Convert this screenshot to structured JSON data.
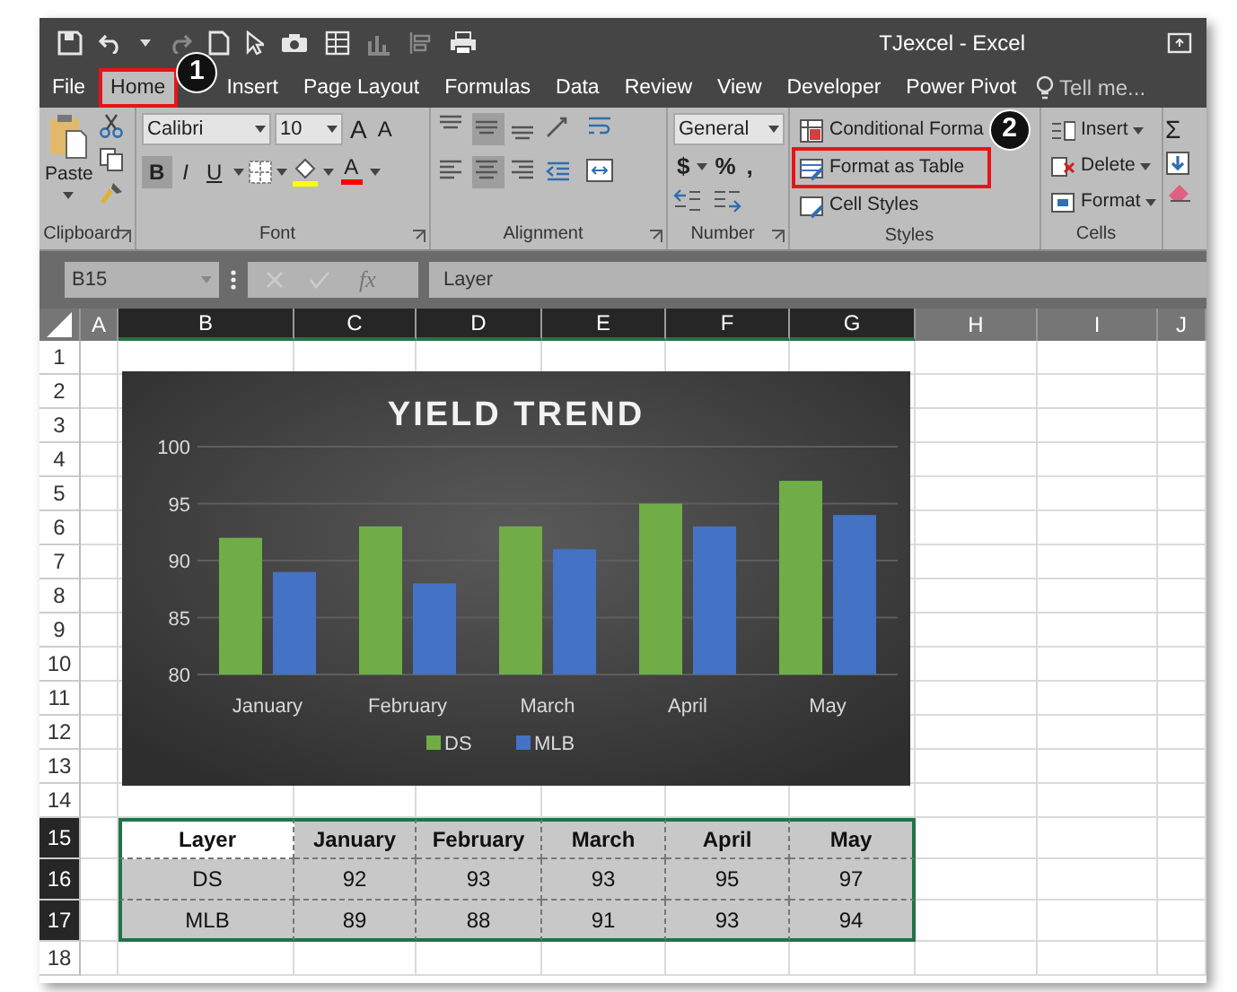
{
  "window": {
    "title": "TJexcel - Excel"
  },
  "tabs": [
    {
      "label": "File",
      "selected": false,
      "highlighted": false
    },
    {
      "label": "Home",
      "selected": true,
      "highlighted": true
    },
    {
      "label": "Insert",
      "selected": false,
      "highlighted": false
    },
    {
      "label": "Page Layout",
      "selected": false,
      "highlighted": false
    },
    {
      "label": "Formulas",
      "selected": false,
      "highlighted": false
    },
    {
      "label": "Data",
      "selected": false,
      "highlighted": false
    },
    {
      "label": "Review",
      "selected": false,
      "highlighted": false
    },
    {
      "label": "View",
      "selected": false,
      "highlighted": false
    },
    {
      "label": "Developer",
      "selected": false,
      "highlighted": false
    },
    {
      "label": "Power Pivot",
      "selected": false,
      "highlighted": false
    }
  ],
  "tell_me": {
    "placeholder": "Tell me..."
  },
  "ribbon": {
    "clipboard": {
      "label": "Clipboard",
      "paste": "Paste"
    },
    "font": {
      "label": "Font",
      "name": "Calibri",
      "size": "10",
      "grow": "A",
      "shrink": "A",
      "styles": [
        {
          "text": "B",
          "kind": "bold",
          "pressed": true
        },
        {
          "text": "I",
          "kind": "italic",
          "pressed": false
        },
        {
          "text": "U",
          "kind": "underline",
          "pressed": false
        }
      ],
      "font_color": "A"
    },
    "alignment": {
      "label": "Alignment",
      "vertical": [
        {
          "kind": "top",
          "pressed": false
        },
        {
          "kind": "middle",
          "pressed": true
        },
        {
          "kind": "bottom",
          "pressed": false
        }
      ],
      "horizontal": [
        {
          "kind": "left",
          "pressed": false
        },
        {
          "kind": "center",
          "pressed": true
        },
        {
          "kind": "right",
          "pressed": false
        }
      ]
    },
    "number": {
      "label": "Number",
      "format": "General",
      "symbols": [
        "$",
        "%",
        ","
      ]
    },
    "styles": {
      "label": "Styles",
      "buttons": [
        {
          "label": "Conditional Forma",
          "highlighted": false
        },
        {
          "label": "Format as Table",
          "highlighted": true
        },
        {
          "label": "Cell Styles",
          "highlighted": false
        }
      ]
    },
    "cells": {
      "label": "Cells",
      "buttons": [
        "Insert",
        "Delete",
        "Format"
      ]
    },
    "editing": {
      "sum": "Σ"
    }
  },
  "callouts": [
    "1",
    "2"
  ],
  "formula_bar": {
    "name_box": "B15",
    "function": "fx",
    "value": "Layer"
  },
  "sheet": {
    "columns": [
      {
        "label": "A",
        "selected": false
      },
      {
        "label": "B",
        "selected": true
      },
      {
        "label": "C",
        "selected": true
      },
      {
        "label": "D",
        "selected": true
      },
      {
        "label": "E",
        "selected": true
      },
      {
        "label": "F",
        "selected": true
      },
      {
        "label": "G",
        "selected": true
      },
      {
        "label": "H",
        "selected": false
      },
      {
        "label": "I",
        "selected": false
      },
      {
        "label": "J",
        "selected": false
      }
    ],
    "rows": [
      {
        "label": "1",
        "selected": false
      },
      {
        "label": "2",
        "selected": false
      },
      {
        "label": "3",
        "selected": false
      },
      {
        "label": "4",
        "selected": false
      },
      {
        "label": "5",
        "selected": false
      },
      {
        "label": "6",
        "selected": false
      },
      {
        "label": "7",
        "selected": false
      },
      {
        "label": "8",
        "selected": false
      },
      {
        "label": "9",
        "selected": false
      },
      {
        "label": "10",
        "selected": false
      },
      {
        "label": "11",
        "selected": false
      },
      {
        "label": "12",
        "selected": false
      },
      {
        "label": "13",
        "selected": false
      },
      {
        "label": "14",
        "selected": false
      },
      {
        "label": "15",
        "selected": true
      },
      {
        "label": "16",
        "selected": true
      },
      {
        "label": "17",
        "selected": true
      },
      {
        "label": "18",
        "selected": false
      }
    ]
  },
  "table": {
    "header": [
      {
        "text": "Layer",
        "active": true
      },
      {
        "text": "January",
        "active": false
      },
      {
        "text": "February",
        "active": false
      },
      {
        "text": "March",
        "active": false
      },
      {
        "text": "April",
        "active": false
      },
      {
        "text": "May",
        "active": false
      }
    ],
    "rows": [
      [
        "DS",
        "92",
        "93",
        "93",
        "95",
        "97"
      ],
      [
        "MLB",
        "89",
        "88",
        "91",
        "93",
        "94"
      ]
    ]
  },
  "chart": {
    "chart_data": {
      "type": "bar",
      "title": "YIELD TREND",
      "categories": [
        "January",
        "February",
        "March",
        "April",
        "May"
      ],
      "series": [
        {
          "name": "DS",
          "color": "#70ad47",
          "values": [
            92,
            93,
            93,
            95,
            97
          ]
        },
        {
          "name": "MLB",
          "color": "#4472c4",
          "values": [
            89,
            88,
            91,
            93,
            94
          ]
        }
      ],
      "ylim": [
        80,
        100
      ],
      "yticks": [
        {
          "value": 80,
          "label": "80"
        },
        {
          "value": 85,
          "label": "85"
        },
        {
          "value": 90,
          "label": "90"
        },
        {
          "value": 95,
          "label": "95"
        },
        {
          "value": 100,
          "label": "100"
        }
      ],
      "grid": true,
      "legend": "bottom"
    }
  }
}
